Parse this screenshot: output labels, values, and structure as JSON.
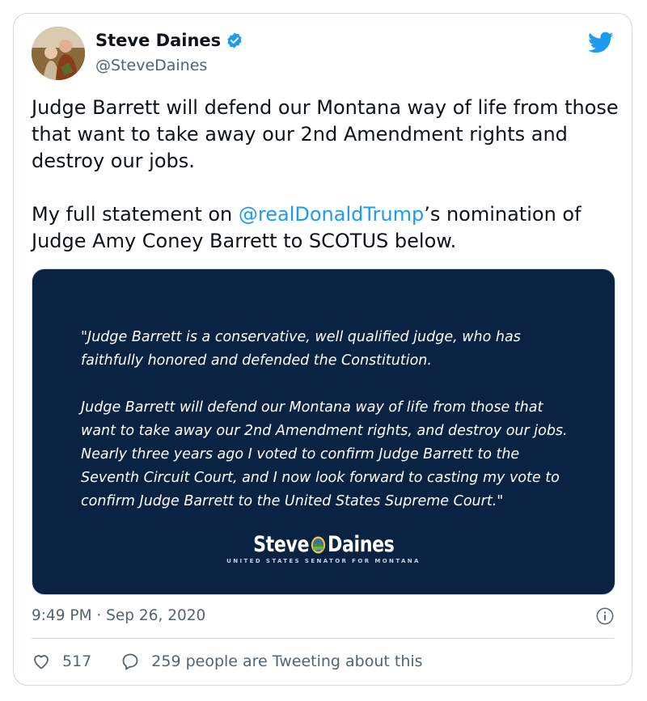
{
  "tweet": {
    "author_name": "Steve Daines",
    "author_handle": "@SteveDaines",
    "body_line1": "Judge Barrett will defend our Montana way of life from those that want to take away our 2nd Amendment rights and destroy our jobs.",
    "body_line2_prefix": "My full statement on ",
    "body_mention": "@realDonaldTrump",
    "body_line2_suffix": "’s nomination of Judge Amy Coney Barrett to SCOTUS below.",
    "timestamp": "9:49 PM · Sep 26, 2020"
  },
  "media": {
    "quote_p1": "\"Judge Barrett is a conservative, well qualified judge, who has faithfully honored and defended the Constitution.",
    "quote_p2": "Judge Barrett will defend our Montana way of life from those that want to take away our 2nd Amendment rights, and destroy our jobs.  Nearly three years ago I voted to confirm Judge Barrett to the Seventh Circuit Court, and I now look forward to casting my vote to confirm Judge Barrett to the United States Supreme Court.\"",
    "sig_first": "Steve",
    "sig_last": "Daines",
    "sig_sub": "UNITED STATES SENATOR FOR MONTANA",
    "background_color": "#0b2342"
  },
  "actions": {
    "likes": "517",
    "conversation": "259 people are Tweeting about this"
  },
  "icons": {
    "verified": "verified-badge-icon",
    "brand": "twitter-bird-icon",
    "info": "info-icon",
    "like": "heart-icon",
    "reply": "speech-bubble-icon"
  },
  "colors": {
    "accent": "#1d9bf0",
    "muted": "#536471",
    "border": "#cfd9de"
  }
}
